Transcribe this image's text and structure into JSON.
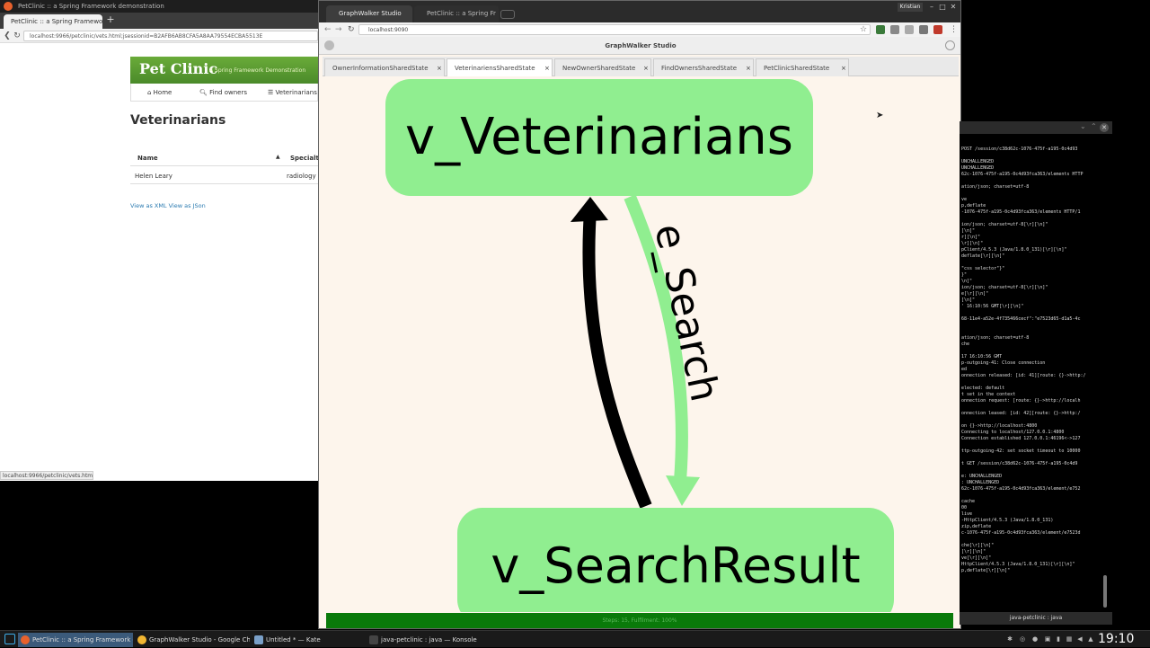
{
  "petclinic_window": {
    "title": "PetClinic :: a Spring Framework demonstration",
    "tab_label": "PetClinic :: a Spring Framewo",
    "new_tab_label": "+",
    "url": "localhost:9966/petclinic/vets.html;jsessionid=B2AFB6AB8CFA5A8AA79554ECBA5513E",
    "banner_logo": "Pet Clinic",
    "banner_tagline": "A Spring Framework Demonstration",
    "nav": [
      "Home",
      "Find owners",
      "Veterinarians"
    ],
    "heading": "Veterinarians",
    "table_headers": [
      "Name",
      "Specialti"
    ],
    "rows": [
      {
        "name": "Helen Leary",
        "specialty": "radiology"
      }
    ],
    "links": "View as XML View as JSon",
    "status": "localhost:9966/petclinic/vets.html"
  },
  "graphwalker_window": {
    "tabs": [
      "GraphWalker Studio",
      "PetClinic :: a Spring Fr"
    ],
    "user": "Kristian",
    "url": "localhost:9090",
    "app_title": "GraphWalker Studio",
    "model_tabs": [
      "OwnerInformationSharedState",
      "VeterinariensSharedState",
      "NewOwnerSharedState",
      "FindOwnersSharedState",
      "PetClinicSharedState"
    ],
    "close_glyph": "×",
    "nodes": {
      "top": "v_Veterinarians",
      "bottom": "v_SearchResult"
    },
    "edge_label": "e_Search",
    "footer": "Steps: 15, Fulfilment: 100%"
  },
  "terminal": {
    "lines": [
      "POST /session/c38d62c-1076-475f-a195-0c4d93",
      "",
      "UNCHALLENGED",
      "UNCHALLENGED",
      "62c-1076-475f-a195-0c4d93fca363/elements HTTP",
      "",
      "ation/json; charset=utf-8",
      "",
      "ve",
      "p,deflate",
      "-1076-475f-a195-0c4d93fca363/elements HTTP/1",
      "",
      "ion/json; charset=utf-8[\\r][\\n]\"",
      "[\\n]\"",
      "r][\\n]\"",
      "\\r][\\n]\"",
      "pClient/4.5.3 (Java/1.8.0_131)[\\r][\\n]\"",
      "deflate[\\r][\\n]\"",
      "",
      "\"css selector\"}\"",
      "}\"",
      "\\n]\"",
      "ion/json; charset=utf-8[\\r][\\n]\"",
      "e[\\r][\\n]\"",
      "[\\n]\"",
      "' 16:10:56 GMT[\\r][\\n]\"",
      "",
      "68-11e4-a52e-4f735466cecf\":\"e7523d65-d1a5-4c",
      "",
      "",
      "ation/json; charset=utf-8",
      "che",
      "",
      "17 16:10:56 GMT",
      "p-outgoing-41: Close connection",
      "ed",
      "onnection released: [id: 41][route: {}->http:/",
      "",
      "elected: default",
      "t set in the context",
      "onnection request: [route: {}->http://localh",
      "",
      "onnection leased: [id: 42][route: {}->http:/",
      "",
      "on {}->http://localhost:4800",
      "Connecting to localhost/127.0.0.1:4800",
      "Connection established 127.0.0.1:46196<->127",
      "",
      "ttp-outgoing-42: set socket timeout to 10000",
      "",
      "t GET /session/c38d62c-1076-475f-a195-0c4d9",
      "",
      "e: UNCHALLENGED",
      ": UNCHALLENGED",
      "62c-1076-475f-a195-0c4d93fca363/element/e752",
      "",
      "cache",
      "00",
      "live",
      "-HttpClient/4.5.3 (Java/1.8.0_131)",
      "zip,deflate",
      "c-1076-475f-a195-0c4d93fca363/element/e7523d",
      "",
      "che[\\r][\\n]\"",
      "[\\r][\\n]\"",
      "ve[\\r][\\n]\"",
      "HttpClient/4.5.3 (Java/1.8.0_131)[\\r][\\n]\"",
      "p,deflate[\\r][\\n]\""
    ],
    "footer": "java-petclinic : java"
  },
  "taskbar": {
    "items": [
      {
        "label": "PetClinic :: a Spring Framework de...",
        "color": "#e8612c"
      },
      {
        "label": "GraphWalker Studio - Google Chro...",
        "color": "#f2b632"
      },
      {
        "label": "Untitled * — Kate",
        "color": "#7aa0c8"
      },
      {
        "label": "java-petclinic : java — Konsole",
        "color": "#444444"
      }
    ],
    "clock": "19:10"
  }
}
